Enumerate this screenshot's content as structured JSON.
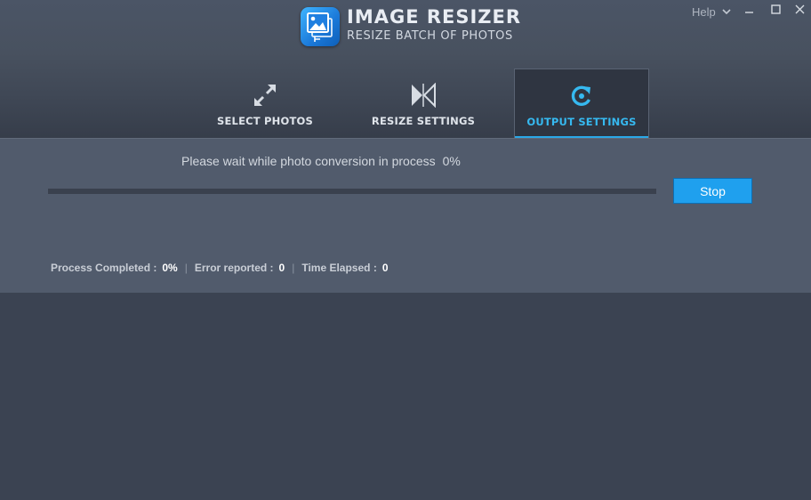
{
  "app": {
    "title": "IMAGE RESIZER",
    "subtitle": "RESIZE BATCH OF PHOTOS"
  },
  "titlebar": {
    "help_label": "Help"
  },
  "tabs": [
    {
      "label": "SELECT PHOTOS",
      "icon": "expand-arrows-icon",
      "active": false
    },
    {
      "label": "RESIZE SETTINGS",
      "icon": "resize-bowtie-icon",
      "active": false
    },
    {
      "label": "OUTPUT SETTINGS",
      "icon": "refresh-icon",
      "active": true
    }
  ],
  "progress": {
    "message": "Please wait while photo conversion in process",
    "percent_text": "0%",
    "value": 0,
    "stop_label": "Stop"
  },
  "stats": {
    "completed_label": "Process Completed :",
    "completed_value": "0%",
    "error_label": "Error reported :",
    "error_value": "0",
    "elapsed_label": "Time Elapsed :",
    "elapsed_value": "0"
  },
  "colors": {
    "accent": "#2aa8e8",
    "button": "#1fa0ee",
    "panel": "#515b6c",
    "background": "#3b4352"
  }
}
